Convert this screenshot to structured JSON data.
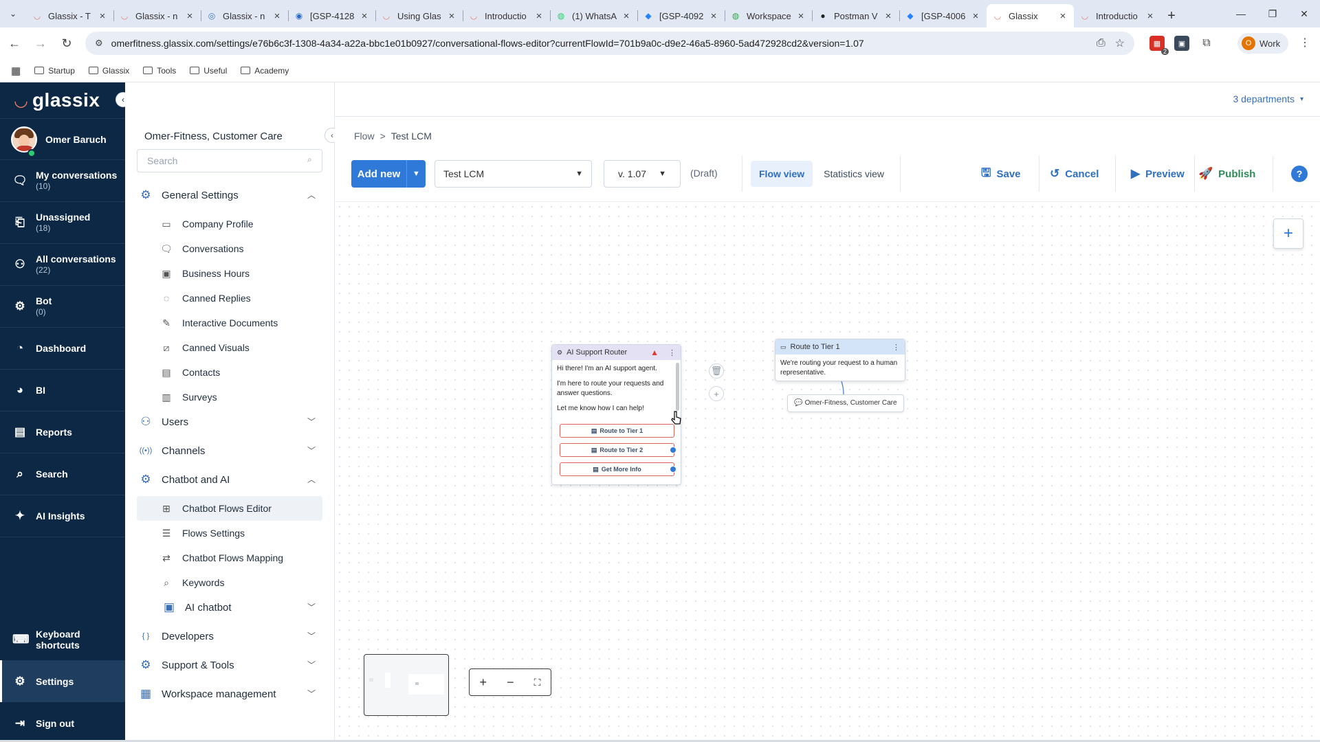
{
  "browser": {
    "tabs": [
      {
        "title": "Glassix - T",
        "icon": "glassix-logo-icon"
      },
      {
        "title": "Glassix - n",
        "icon": "glassix-logo-icon"
      },
      {
        "title": "Glassix - n",
        "icon": "globe-icon"
      },
      {
        "title": "[GSP-4128",
        "icon": "chrome-icon"
      },
      {
        "title": "Using Glas",
        "icon": "glassix-logo-icon"
      },
      {
        "title": "Introductio",
        "icon": "glassix-logo-icon"
      },
      {
        "title": "(1) WhatsA",
        "icon": "whatsapp-icon"
      },
      {
        "title": "[GSP-4092",
        "icon": "jira-icon"
      },
      {
        "title": "Workspace",
        "icon": "workspace-icon"
      },
      {
        "title": "Postman V",
        "icon": "postman-icon"
      },
      {
        "title": "[GSP-4006",
        "icon": "jira-icon"
      },
      {
        "title": "Glassix",
        "icon": "glassix-logo-icon",
        "active": true
      },
      {
        "title": "Introductio",
        "icon": "glassix-logo-icon"
      }
    ],
    "url": "omerfitness.glassix.com/settings/e76b6c3f-1308-4a34-a22a-bbc1e01b0927/conversational-flows-editor?currentFlowId=701b9a0c-d9e2-46a5-8960-5ad472928cd2&version=1.07",
    "profile": {
      "initial": "O",
      "label": "Work"
    },
    "extension_badge": "2",
    "bookmarks": [
      "Startup",
      "Glassix",
      "Tools",
      "Useful",
      "Academy"
    ]
  },
  "leftnav": {
    "logo_text": "glassix",
    "user_name": "Omer Baruch",
    "items": [
      {
        "label": "My conversations",
        "count": "(10)",
        "icon": "chat-bubbles-icon"
      },
      {
        "label": "Unassigned",
        "count": "(18)",
        "icon": "inbox-icon"
      },
      {
        "label": "All conversations",
        "count": "(22)",
        "icon": "people-icon"
      },
      {
        "label": "Bot",
        "count": "(0)",
        "icon": "bot-icon"
      },
      {
        "label": "Dashboard",
        "count": "",
        "icon": "dashboard-icon"
      },
      {
        "label": "BI",
        "count": "",
        "icon": "pie-chart-icon"
      },
      {
        "label": "Reports",
        "count": "",
        "icon": "report-icon"
      },
      {
        "label": "Search",
        "count": "",
        "icon": "search-icon"
      },
      {
        "label": "AI Insights",
        "count": "",
        "icon": "sparkle-icon"
      }
    ],
    "bottom_items": [
      {
        "label": "Keyboard shortcuts",
        "icon": "keyboard-icon"
      },
      {
        "label": "Settings",
        "icon": "gear-icon",
        "active": true
      },
      {
        "label": "Sign out",
        "icon": "sign-out-icon"
      }
    ]
  },
  "settings_sidebar": {
    "org_title": "Omer-Fitness, Customer Care",
    "search_placeholder": "Search",
    "groups": [
      {
        "label": "General Settings",
        "expanded": true,
        "items": [
          "Company Profile",
          "Conversations",
          "Business Hours",
          "Canned Replies",
          "Interactive Documents",
          "Canned Visuals",
          "Contacts",
          "Surveys"
        ]
      },
      {
        "label": "Users",
        "expanded": false,
        "items": []
      },
      {
        "label": "Channels",
        "expanded": false,
        "items": []
      },
      {
        "label": "Chatbot and AI",
        "expanded": true,
        "items": [
          "Chatbot Flows Editor",
          "Flows Settings",
          "Chatbot Flows Mapping",
          "Keywords"
        ]
      },
      {
        "label": "AI chatbot",
        "expanded": false,
        "items": []
      },
      {
        "label": "Developers",
        "expanded": false,
        "items": []
      },
      {
        "label": "Support & Tools",
        "expanded": false,
        "items": []
      },
      {
        "label": "Workspace management",
        "expanded": false,
        "items": []
      }
    ],
    "active_item": "Chatbot Flows Editor"
  },
  "main": {
    "departments": "3 departments",
    "breadcrumb": {
      "root": "Flow",
      "separator": ">",
      "current": "Test LCM"
    },
    "toolbar": {
      "add_new": "Add new",
      "flow_name": "Test LCM",
      "version": "v. 1.07",
      "status": "(Draft)",
      "flow_view": "Flow view",
      "statistics_view": "Statistics view",
      "save": "Save",
      "cancel": "Cancel",
      "preview": "Preview",
      "publish": "Publish",
      "help": "?"
    }
  },
  "flow": {
    "router_node": {
      "title": "AI Support Router",
      "text_lines": [
        "Hi there! I'm an AI support agent.",
        "I'm here to route your requests and answer questions.",
        "Let me know how I can help!"
      ],
      "buttons": [
        "Route to Tier 1",
        "Route to Tier 2",
        "Get More Info"
      ]
    },
    "tier1_node": {
      "title": "Route to Tier 1",
      "text": "We're routing your request to a human representative."
    },
    "department_node": {
      "label": "Omer-Fitness, Customer Care"
    }
  },
  "colors": {
    "nav_bg": "#0c2845",
    "accent": "#2f7ad9",
    "warning": "#e03c31",
    "publish": "#2e8b57"
  }
}
